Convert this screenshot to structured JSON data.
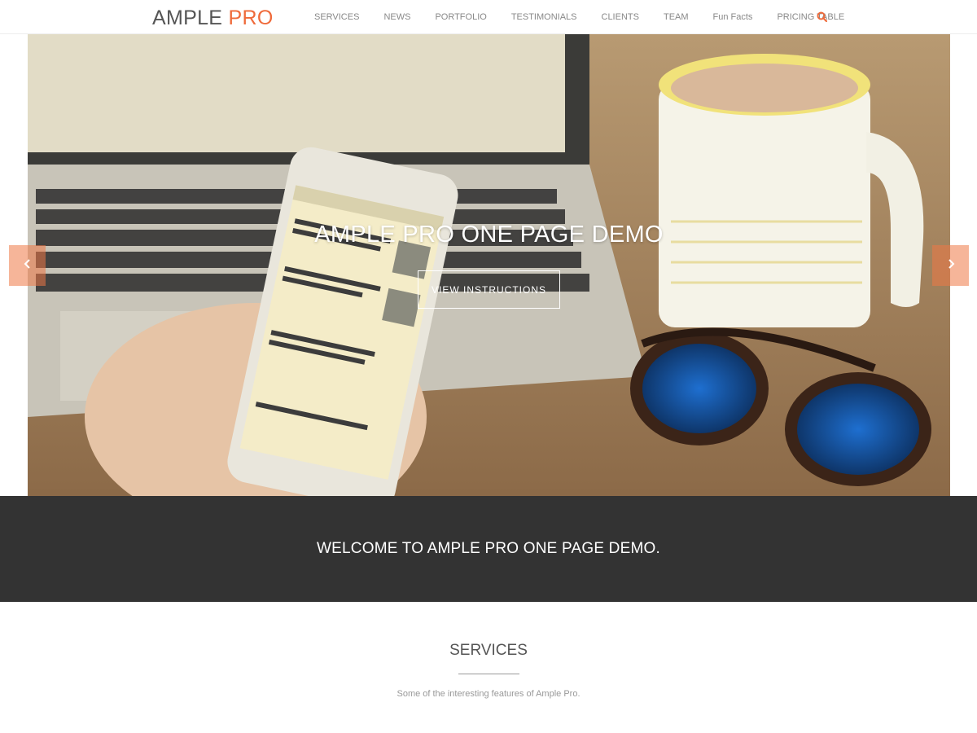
{
  "brand": {
    "name": "AMPLE",
    "accent_word": "PRO",
    "accent_color": "#ef6a3a"
  },
  "nav": {
    "items": [
      {
        "label": "SERVICES"
      },
      {
        "label": "NEWS"
      },
      {
        "label": "PORTFOLIO"
      },
      {
        "label": "TESTIMONIALS"
      },
      {
        "label": "CLIENTS"
      },
      {
        "label": "TEAM"
      },
      {
        "label": "Fun Facts"
      },
      {
        "label": "PRICING TABLE"
      }
    ],
    "search_icon": "search-icon"
  },
  "hero": {
    "title": "AMPLE PRO ONE PAGE DEMO",
    "button_label": "VIEW INSTRUCTIONS",
    "prev_icon": "chevron-left-icon",
    "next_icon": "chevron-right-icon",
    "arrow_color": "#ef7846"
  },
  "welcome": {
    "text": "WELCOME TO AMPLE PRO ONE PAGE DEMO.",
    "background": "#333333"
  },
  "services": {
    "title": "SERVICES",
    "subtitle": "Some of the interesting features of Ample Pro."
  }
}
